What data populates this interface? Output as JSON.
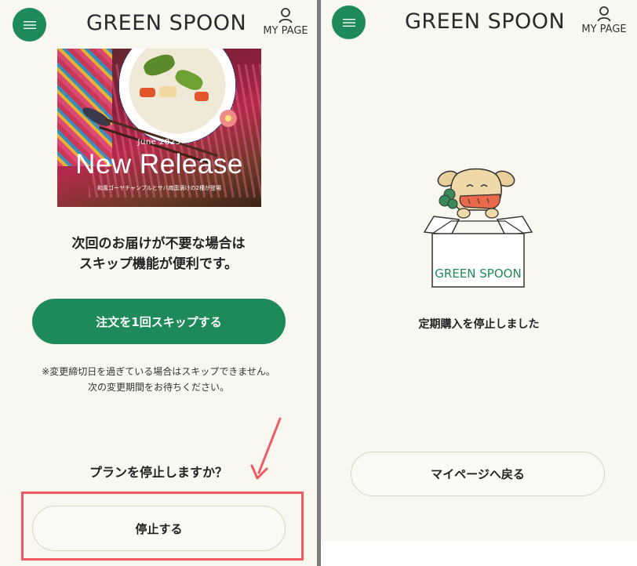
{
  "left": {
    "header": {
      "logo": "GREEN SPOON",
      "mypage_label": "MY PAGE"
    },
    "banner": {
      "date": "June 2025",
      "title": "New Release",
      "caption": "和風ゴーヤチャンプルとサバ南蛮漬けの2種が登場"
    },
    "headline": [
      "次回のお届けが不要な場合は",
      "スキップ機能が便利です。"
    ],
    "skip_button": "注文を1回スキップする",
    "note": [
      "※変更締切日を過ぎている場合はスキップできません。",
      "次の変更期間をお待ちください。"
    ],
    "question": "プランを停止しますか？",
    "stop_button": "停止する"
  },
  "right": {
    "header": {
      "logo": "GREEN SPOON",
      "mypage_label": "MY PAGE"
    },
    "illustration_box_text": "GREEN SPOON",
    "message": "定期購入を停止しました",
    "back_button": "マイページへ戻る"
  },
  "colors": {
    "brand_green": "#1e8a5a",
    "highlight_red": "#ef5a64",
    "background": "#f8f7f0"
  },
  "icons": [
    "menu-icon",
    "user-icon"
  ]
}
